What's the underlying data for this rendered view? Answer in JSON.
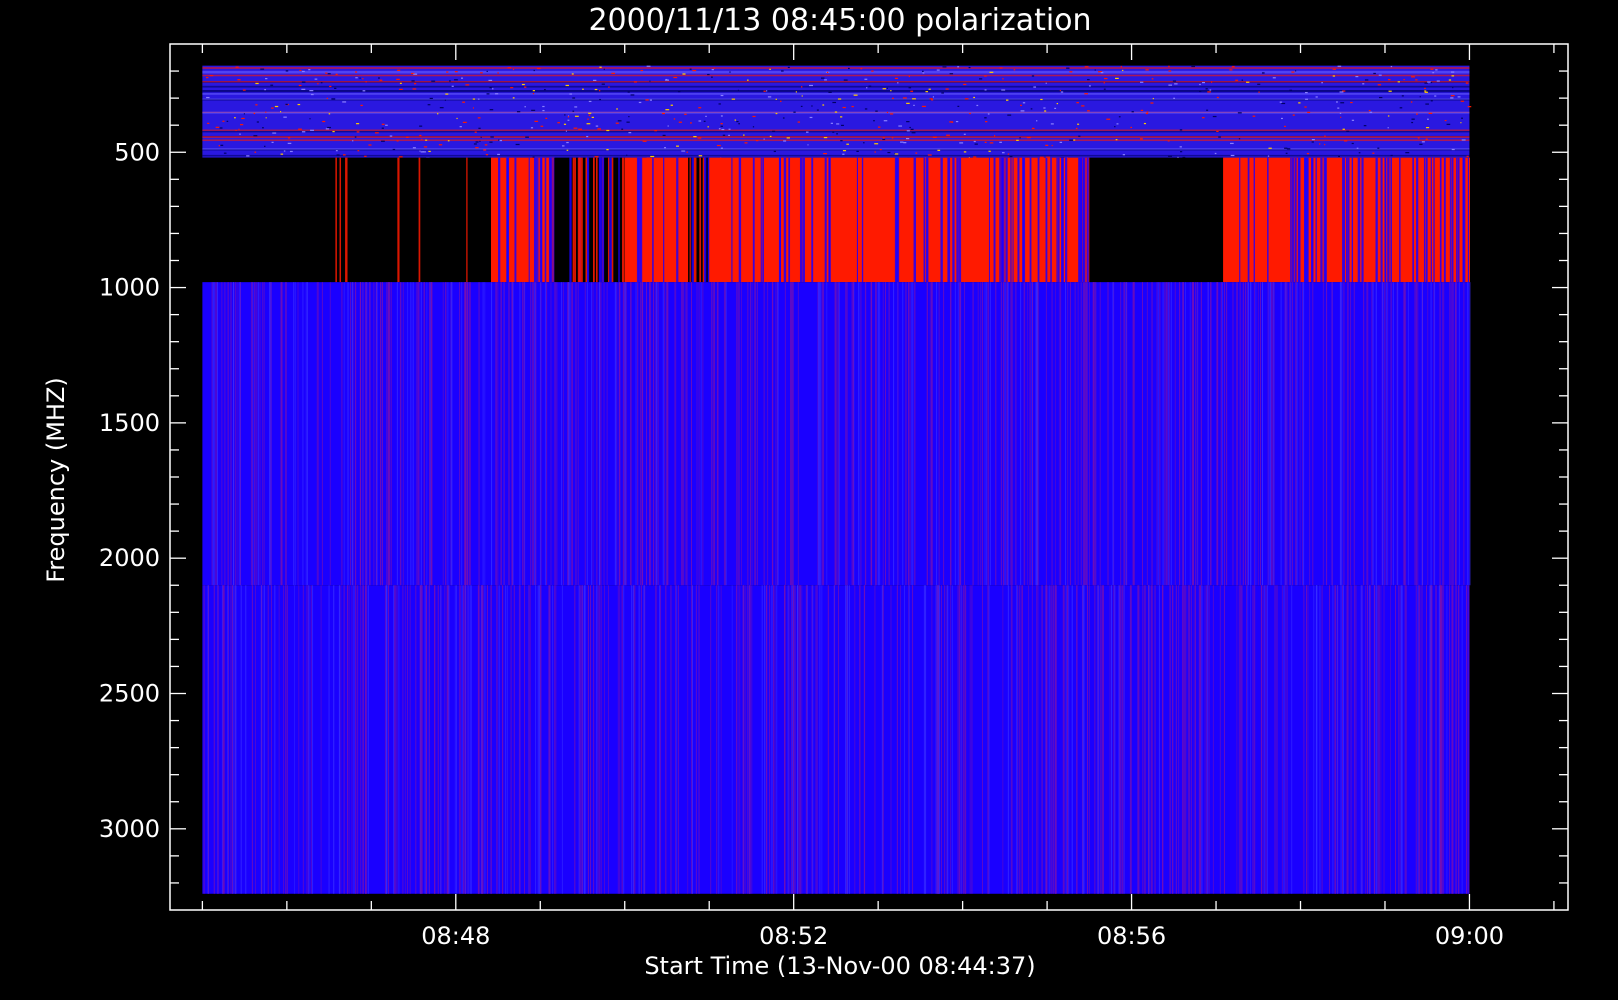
{
  "chart_data": {
    "type": "heatmap",
    "title": "2000/11/13 08:45:00 polarization",
    "xlabel": "Start Time (13-Nov-00 08:44:37)",
    "ylabel": "Frequency (MHZ)",
    "x_ticks": [
      "08:48",
      "08:52",
      "08:56",
      "09:00"
    ],
    "y_ticks": [
      "500",
      "1000",
      "1500",
      "2000",
      "2500",
      "3000"
    ],
    "xlim": [
      "08:44:37",
      "09:01:10"
    ],
    "ylim": [
      3300,
      100
    ],
    "y_reversed": true,
    "data_extent": {
      "x": [
        "08:45:00",
        "09:00:00"
      ],
      "y": [
        180,
        3240
      ]
    },
    "bands": [
      {
        "freq_range": [
          180,
          520
        ],
        "description": "noisy blue band with red speckles"
      },
      {
        "freq_range": [
          520,
          980
        ],
        "segments": [
          {
            "from": "08:45:00",
            "to": "08:46:30",
            "level": "none"
          },
          {
            "from": "08:46:30",
            "to": "08:48:25",
            "level": "none-with-sparse-lines"
          },
          {
            "from": "08:48:25",
            "to": "08:49:10",
            "level": "red-dense-lines"
          },
          {
            "from": "08:49:10",
            "to": "08:49:20",
            "level": "none"
          },
          {
            "from": "08:49:20",
            "to": "08:50:00",
            "level": "mixed"
          },
          {
            "from": "08:50:00",
            "to": "08:50:45",
            "level": "red"
          },
          {
            "from": "08:50:45",
            "to": "08:51:00",
            "level": "mixed"
          },
          {
            "from": "08:51:00",
            "to": "08:54:10",
            "level": "red"
          },
          {
            "from": "08:54:10",
            "to": "08:55:30",
            "level": "red-dense-lines"
          },
          {
            "from": "08:55:30",
            "to": "08:57:05",
            "level": "none"
          },
          {
            "from": "08:57:05",
            "to": "08:58:00",
            "level": "red"
          },
          {
            "from": "08:58:00",
            "to": "09:00:00",
            "level": "red-dense-lines"
          }
        ]
      },
      {
        "freq_range": [
          980,
          2100
        ],
        "description": "blue with fine red striations"
      },
      {
        "freq_range": [
          2100,
          3240
        ],
        "description": "blue with fine red striations"
      }
    ],
    "colors": {
      "background": "#000000",
      "blue": "#1a00ff",
      "red": "#ff1a00",
      "axes": "#ffffff"
    }
  }
}
